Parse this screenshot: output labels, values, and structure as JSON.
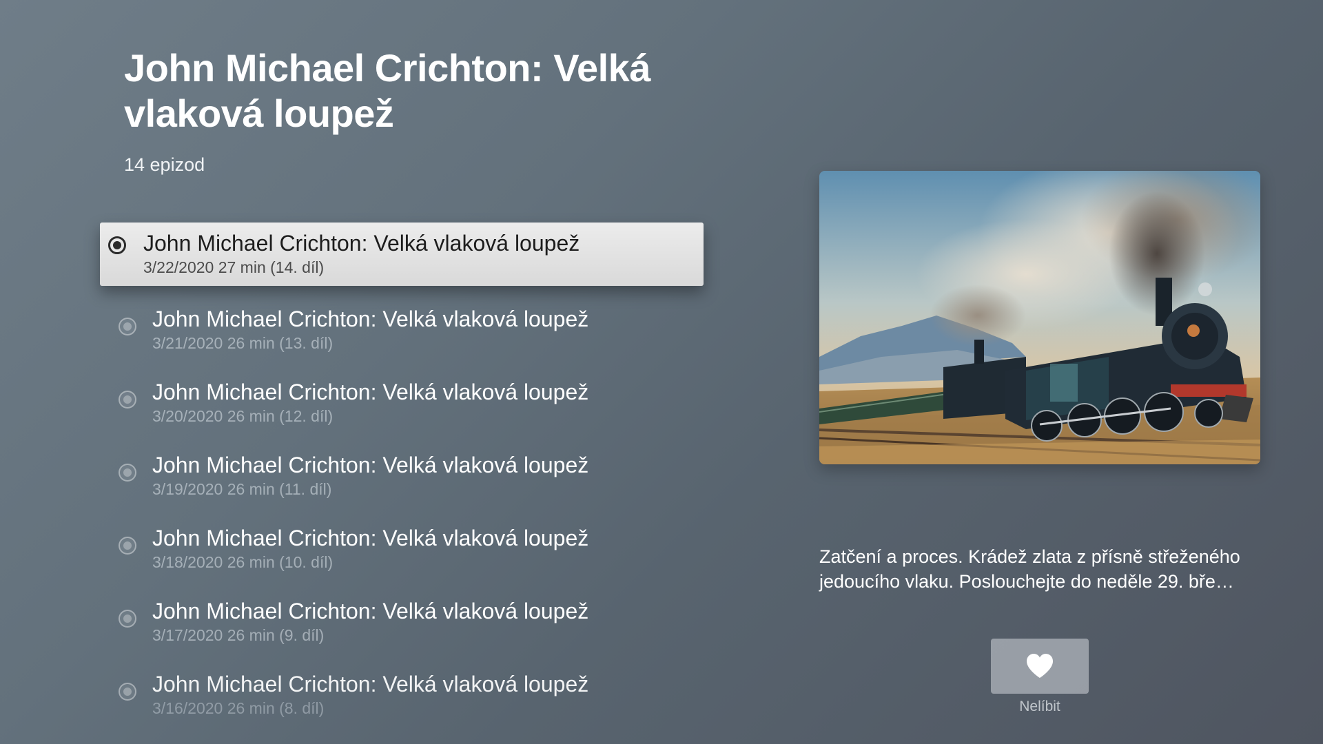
{
  "podcast": {
    "title": "John Michael Crichton: Velká vlaková loupež",
    "episode_count": "14 epizod",
    "artwork_icon": "steam-locomotive-artwork"
  },
  "episodes": [
    {
      "title": "John Michael Crichton: Velká vlaková loupež",
      "meta": "3/22/2020  27 min (14. díl)",
      "focused": true
    },
    {
      "title": "John Michael Crichton: Velká vlaková loupež",
      "meta": "3/21/2020  26 min (13. díl)",
      "focused": false
    },
    {
      "title": "John Michael Crichton: Velká vlaková loupež",
      "meta": "3/20/2020  26 min (12. díl)",
      "focused": false
    },
    {
      "title": "John Michael Crichton: Velká vlaková loupež",
      "meta": "3/19/2020  26 min (11. díl)",
      "focused": false
    },
    {
      "title": "John Michael Crichton: Velká vlaková loupež",
      "meta": "3/18/2020  26 min (10. díl)",
      "focused": false
    },
    {
      "title": "John Michael Crichton: Velká vlaková loupež",
      "meta": "3/17/2020  26 min (9. díl)",
      "focused": false
    },
    {
      "title": "John Michael Crichton: Velká vlaková loupež",
      "meta": "3/16/2020  26 min (8. díl)",
      "focused": false
    }
  ],
  "details": {
    "description": "Zatčení a proces. Krádež zlata z přísně střeženého jedoucího vlaku. Poslouchejte do neděle 29. bře…",
    "like_label": "Nelíbit",
    "like_icon": "heart-icon"
  },
  "colors": {
    "focus_background": "#e3e3e3",
    "focus_text": "#1d1d1d",
    "muted_text": "#c9d1d7"
  }
}
